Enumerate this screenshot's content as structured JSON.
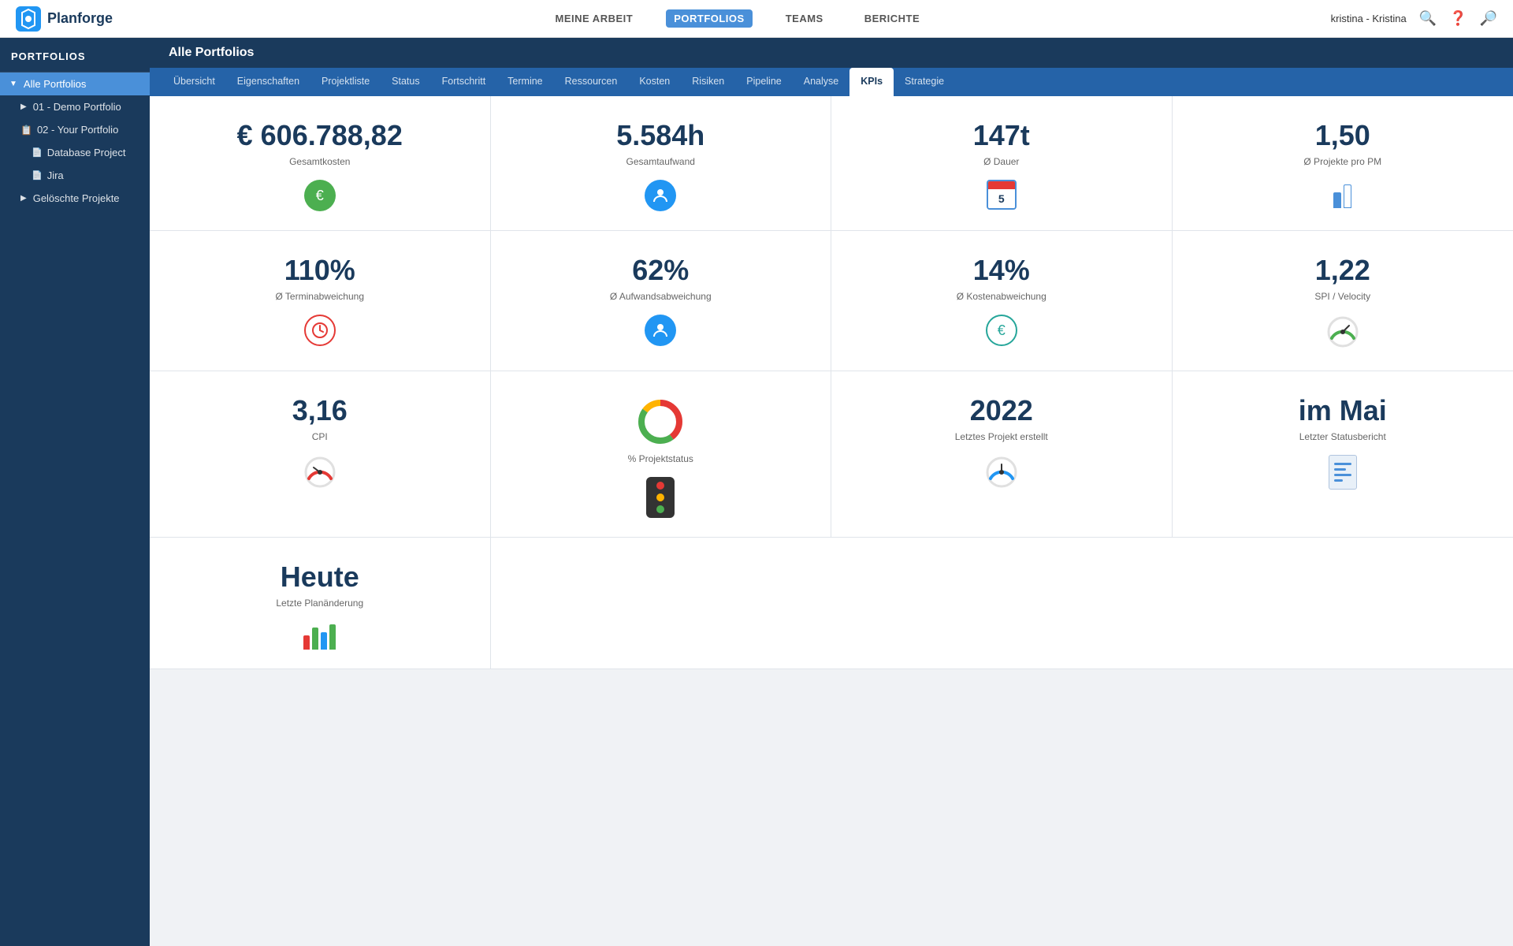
{
  "app": {
    "logo_text": "Planforge"
  },
  "topnav": {
    "links": [
      {
        "id": "meine-arbeit",
        "label": "MEINE ARBEIT",
        "active": false
      },
      {
        "id": "portfolios",
        "label": "PORTFOLIOS",
        "active": true
      },
      {
        "id": "teams",
        "label": "TEAMS",
        "active": false
      },
      {
        "id": "berichte",
        "label": "BERICHTE",
        "active": false
      }
    ],
    "user_label": "kristina - Kristina"
  },
  "sidebar": {
    "header": "PORTFOLIOS",
    "items": [
      {
        "id": "alle-portfolios",
        "label": "Alle Portfolios",
        "icon": "📁",
        "active": true,
        "indent": 0
      },
      {
        "id": "demo-portfolio",
        "label": "01 - Demo Portfolio",
        "icon": "📋",
        "active": false,
        "indent": 1
      },
      {
        "id": "your-portfolio",
        "label": "02 - Your Portfolio",
        "icon": "📋",
        "active": false,
        "indent": 1
      },
      {
        "id": "database-project",
        "label": "Database Project",
        "icon": "📄",
        "active": false,
        "indent": 2
      },
      {
        "id": "jira",
        "label": "Jira",
        "icon": "📄",
        "active": false,
        "indent": 2
      },
      {
        "id": "geloschte-projekte",
        "label": "Gelöschte Projekte",
        "icon": "🗑",
        "active": false,
        "indent": 1
      }
    ]
  },
  "content_header": {
    "title": "Alle Portfolios"
  },
  "tabs": [
    {
      "id": "ubersicht",
      "label": "Übersicht"
    },
    {
      "id": "eigenschaften",
      "label": "Eigenschaften"
    },
    {
      "id": "projektliste",
      "label": "Projektliste"
    },
    {
      "id": "status",
      "label": "Status"
    },
    {
      "id": "fortschritt",
      "label": "Fortschritt"
    },
    {
      "id": "termine",
      "label": "Termine"
    },
    {
      "id": "ressourcen",
      "label": "Ressourcen"
    },
    {
      "id": "kosten",
      "label": "Kosten"
    },
    {
      "id": "risiken",
      "label": "Risiken"
    },
    {
      "id": "pipeline",
      "label": "Pipeline"
    },
    {
      "id": "analyse",
      "label": "Analyse"
    },
    {
      "id": "kpis",
      "label": "KPIs",
      "active": true
    },
    {
      "id": "strategie",
      "label": "Strategie"
    }
  ],
  "kpis": {
    "row1": [
      {
        "id": "gesamtkosten",
        "value": "€ 606.788,82",
        "label": "Gesamtkosten",
        "icon_type": "euro-green"
      },
      {
        "id": "gesamtaufwand",
        "value": "5.584h",
        "label": "Gesamtaufwand",
        "icon_type": "person-blue"
      },
      {
        "id": "dauer",
        "value": "147t",
        "label": "Ø Dauer",
        "icon_type": "calendar"
      },
      {
        "id": "projekte-pm",
        "value": "1,50",
        "label": "Ø Projekte pro PM",
        "icon_type": "pm-bar"
      }
    ],
    "row2": [
      {
        "id": "terminabweichung",
        "value": "110%",
        "label": "Ø Terminabweichung",
        "icon_type": "clock-red"
      },
      {
        "id": "aufwandsabweichung",
        "value": "62%",
        "label": "Ø Aufwandsabweichung",
        "icon_type": "person-circle-blue"
      },
      {
        "id": "kostenabweichung",
        "value": "14%",
        "label": "Ø Kostenabweichung",
        "icon_type": "euro-circle-teal"
      },
      {
        "id": "spi-velocity",
        "value": "1,22",
        "label": "SPI / Velocity",
        "icon_type": "speedo-green"
      }
    ],
    "row3": [
      {
        "id": "cpi",
        "value": "3,16",
        "label": "CPI",
        "icon_type": "speedo-red"
      },
      {
        "id": "projektstatus",
        "value": "% Projektstatus",
        "label": "% Projektstatus",
        "icon_type": "donut",
        "value_display": ""
      },
      {
        "id": "letztes-projekt",
        "value": "2022",
        "label": "Letztes Projekt erstellt",
        "icon_type": "speedo-blue"
      },
      {
        "id": "statusbericht",
        "value": "im Mai",
        "label": "Letzter Statusbericht",
        "icon_type": "report"
      }
    ],
    "row4": [
      {
        "id": "letzte-planänderung",
        "value": "Heute",
        "label": "Letzte Planänderung",
        "icon_type": "chart-bars"
      }
    ]
  }
}
